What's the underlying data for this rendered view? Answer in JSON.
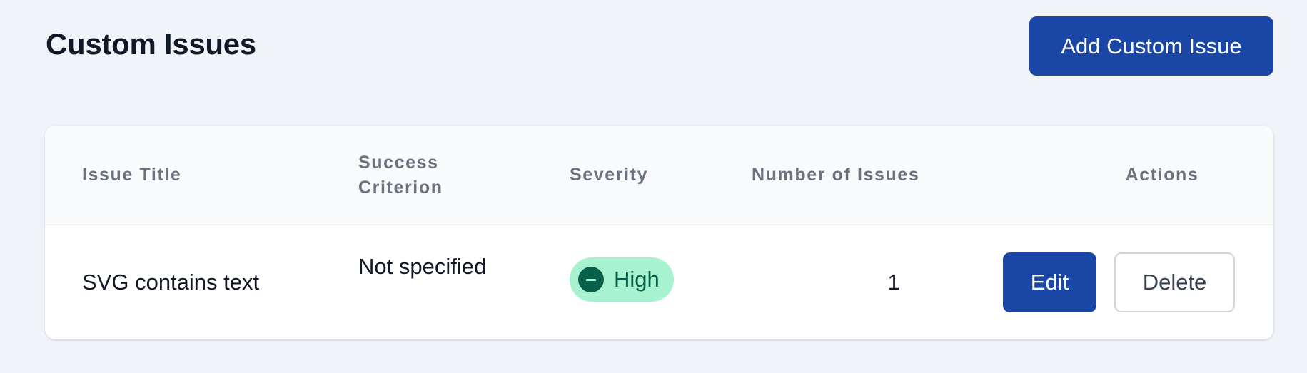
{
  "header": {
    "title": "Custom Issues",
    "add_button_label": "Add Custom Issue"
  },
  "table": {
    "columns": [
      "Issue Title",
      "Success Criterion",
      "Severity",
      "Number of Issues",
      "Actions"
    ],
    "rows": [
      {
        "issue_title": "SVG contains text",
        "success_criterion": "Not specified",
        "severity": "High",
        "severity_icon": "minus-circle-icon",
        "number_of_issues": "1",
        "actions": {
          "edit_label": "Edit",
          "delete_label": "Delete"
        }
      }
    ]
  },
  "colors": {
    "primary": "#1a46a6",
    "page_background": "#f0f4f9",
    "badge_background": "#a7f3d0",
    "badge_text": "#065f46"
  }
}
